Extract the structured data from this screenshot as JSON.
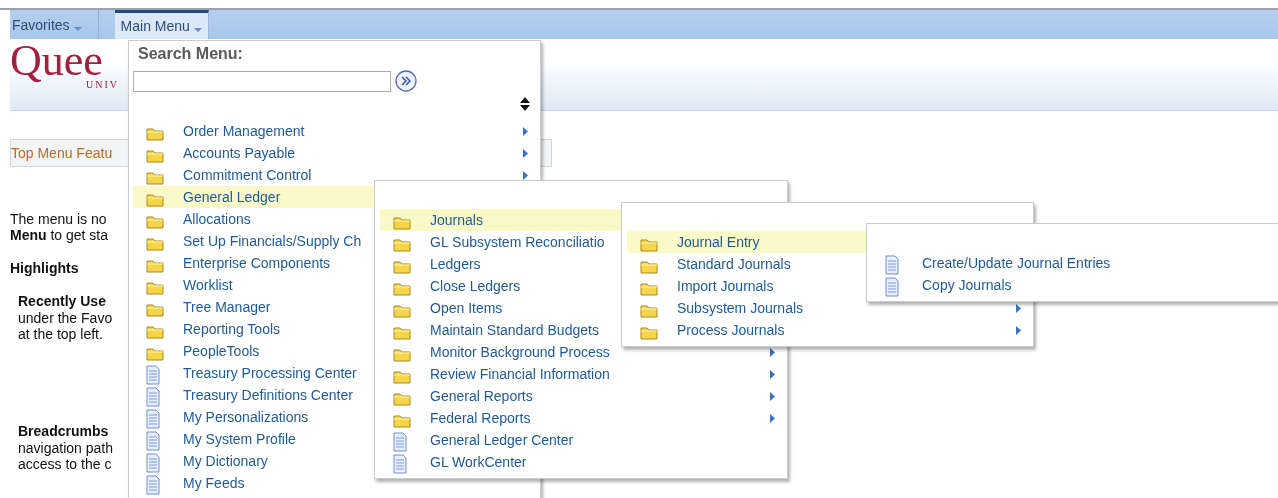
{
  "nav_tabs": [
    {
      "label": "Favorites",
      "selected": false
    },
    {
      "label": "Main Menu",
      "selected": true
    }
  ],
  "logo": {
    "text": "Quee",
    "subtext": "UNIV"
  },
  "page": {
    "panel_title": "Top Menu Featu",
    "intro_lines": [
      "The menu is no",
      "**Menu** to get sta"
    ],
    "heading": "Highlights",
    "sections": [
      {
        "title": "Recently Use",
        "lines": [
          "under the Favo",
          "at the top left."
        ]
      },
      {
        "title": "Breadcrumbs",
        "lines": [
          "navigation path",
          "access to the c"
        ]
      }
    ]
  },
  "main_menu": {
    "search_label": "Search Menu:",
    "items": [
      {
        "label": "Order Management",
        "kind": "folder",
        "selected": false,
        "arrow": true
      },
      {
        "label": "Accounts Payable",
        "kind": "folder",
        "selected": false,
        "arrow": true
      },
      {
        "label": "Commitment Control",
        "kind": "folder",
        "selected": false,
        "arrow": true
      },
      {
        "label": "General Ledger",
        "kind": "folder",
        "selected": true,
        "arrow": false
      },
      {
        "label": "Allocations",
        "kind": "folder",
        "selected": false,
        "arrow": false
      },
      {
        "label": "Set Up Financials/Supply Ch",
        "kind": "folder",
        "selected": false,
        "arrow": false
      },
      {
        "label": "Enterprise Components",
        "kind": "folder",
        "selected": false,
        "arrow": false
      },
      {
        "label": "Worklist",
        "kind": "folder",
        "selected": false,
        "arrow": false
      },
      {
        "label": "Tree Manager",
        "kind": "folder",
        "selected": false,
        "arrow": false
      },
      {
        "label": "Reporting Tools",
        "kind": "folder",
        "selected": false,
        "arrow": false
      },
      {
        "label": "PeopleTools",
        "kind": "folder",
        "selected": false,
        "arrow": false
      },
      {
        "label": "Treasury Processing Center",
        "kind": "page",
        "selected": false,
        "arrow": false
      },
      {
        "label": "Treasury Definitions Center",
        "kind": "page",
        "selected": false,
        "arrow": false
      },
      {
        "label": "My Personalizations",
        "kind": "page",
        "selected": false,
        "arrow": false
      },
      {
        "label": "My System Profile",
        "kind": "page",
        "selected": false,
        "arrow": false
      },
      {
        "label": "My Dictionary",
        "kind": "page",
        "selected": false,
        "arrow": false
      },
      {
        "label": "My Feeds",
        "kind": "page",
        "selected": false,
        "arrow": false
      }
    ]
  },
  "submenus": [
    {
      "items": [
        {
          "label": "Journals",
          "kind": "folder",
          "selected": true,
          "arrow": false
        },
        {
          "label": "GL Subsystem Reconciliatio",
          "kind": "folder",
          "selected": false,
          "arrow": false
        },
        {
          "label": "Ledgers",
          "kind": "folder",
          "selected": false,
          "arrow": false
        },
        {
          "label": "Close Ledgers",
          "kind": "folder",
          "selected": false,
          "arrow": false
        },
        {
          "label": "Open Items",
          "kind": "folder",
          "selected": false,
          "arrow": false
        },
        {
          "label": "Maintain Standard Budgets",
          "kind": "folder",
          "selected": false,
          "arrow": false
        },
        {
          "label": "Monitor Background Process",
          "kind": "folder",
          "selected": false,
          "arrow": true
        },
        {
          "label": "Review Financial Information",
          "kind": "folder",
          "selected": false,
          "arrow": true
        },
        {
          "label": "General Reports",
          "kind": "folder",
          "selected": false,
          "arrow": true
        },
        {
          "label": "Federal Reports",
          "kind": "folder",
          "selected": false,
          "arrow": true
        },
        {
          "label": "General Ledger Center",
          "kind": "page",
          "selected": false,
          "arrow": false
        },
        {
          "label": "GL WorkCenter",
          "kind": "page",
          "selected": false,
          "arrow": false
        }
      ]
    },
    {
      "items": [
        {
          "label": "Journal Entry",
          "kind": "folder",
          "selected": true,
          "arrow": false
        },
        {
          "label": "Standard Journals",
          "kind": "folder",
          "selected": false,
          "arrow": false
        },
        {
          "label": "Import Journals",
          "kind": "folder",
          "selected": false,
          "arrow": false
        },
        {
          "label": "Subsystem Journals",
          "kind": "folder",
          "selected": false,
          "arrow": true
        },
        {
          "label": "Process Journals",
          "kind": "folder",
          "selected": false,
          "arrow": true
        }
      ]
    },
    {
      "items": [
        {
          "label": "Create/Update Journal Entries",
          "kind": "page",
          "selected": false,
          "arrow": false
        },
        {
          "label": "Copy Journals",
          "kind": "page",
          "selected": false,
          "arrow": false
        }
      ]
    }
  ]
}
